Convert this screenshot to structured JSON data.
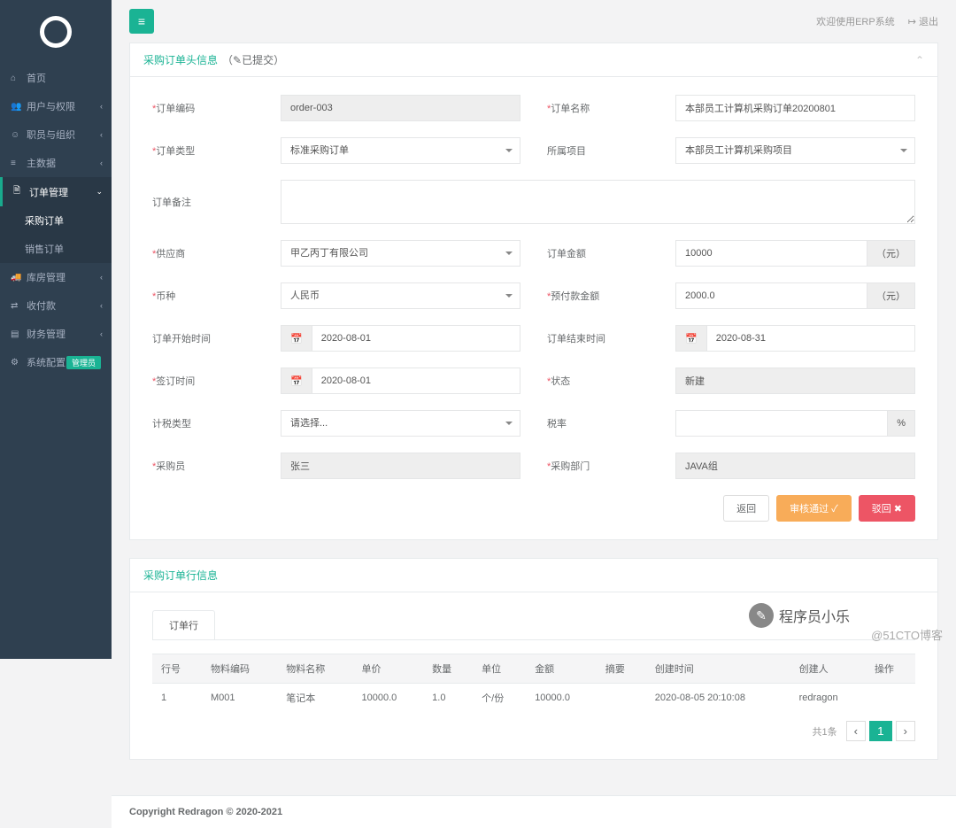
{
  "topbar": {
    "welcome": "欢迎使用ERP系统",
    "logout": "退出"
  },
  "sidebar": {
    "items": [
      {
        "icon": "⌂",
        "label": "首页"
      },
      {
        "icon": "👥",
        "label": "用户与权限",
        "arrow": "‹"
      },
      {
        "icon": "☺",
        "label": "职员与组织",
        "arrow": "‹"
      },
      {
        "icon": "≡",
        "label": "主数据",
        "arrow": "‹"
      },
      {
        "icon": "🗎",
        "label": "订单管理",
        "arrow": "⌄",
        "active": true,
        "sub": [
          {
            "label": "采购订单",
            "sel": true
          },
          {
            "label": "销售订单"
          }
        ]
      },
      {
        "icon": "🚚",
        "label": "库房管理",
        "arrow": "‹"
      },
      {
        "icon": "⇄",
        "label": "收付款",
        "arrow": "‹"
      },
      {
        "icon": "▤",
        "label": "财务管理",
        "arrow": "‹"
      },
      {
        "icon": "⚙",
        "label": "系统配置",
        "badge": "管理员"
      }
    ]
  },
  "panel1": {
    "title": "采购订单头信息",
    "status": "（✎已提交）"
  },
  "form": {
    "order_code": {
      "label": "订单编码",
      "value": "order-003"
    },
    "order_name": {
      "label": "订单名称",
      "value": "本部员工计算机采购订单20200801"
    },
    "order_type": {
      "label": "订单类型",
      "value": "标准采购订单"
    },
    "project": {
      "label": "所属项目",
      "value": "本部员工计算机采购项目"
    },
    "remark": {
      "label": "订单备注",
      "value": ""
    },
    "supplier": {
      "label": "供应商",
      "value": "甲乙丙丁有限公司"
    },
    "amount": {
      "label": "订单金额",
      "value": "10000",
      "unit": "（元）"
    },
    "currency": {
      "label": "币种",
      "value": "人民币"
    },
    "prepay": {
      "label": "预付款金额",
      "value": "2000.0",
      "unit": "（元）"
    },
    "start": {
      "label": "订单开始时间",
      "value": "2020-08-01"
    },
    "end": {
      "label": "订单结束时间",
      "value": "2020-08-31"
    },
    "sign": {
      "label": "签订时间",
      "value": "2020-08-01"
    },
    "state": {
      "label": "状态",
      "value": "新建"
    },
    "tax_type": {
      "label": "计税类型",
      "value": "请选择..."
    },
    "tax_rate": {
      "label": "税率",
      "value": "",
      "unit": "%"
    },
    "buyer": {
      "label": "采购员",
      "value": "张三"
    },
    "dept": {
      "label": "采购部门",
      "value": "JAVA组"
    }
  },
  "buttons": {
    "back": "返回",
    "approve": "审核通过 ✓",
    "reject": "驳回 ✖"
  },
  "panel2": {
    "title": "采购订单行信息",
    "tab": "订单行"
  },
  "table": {
    "headers": [
      "行号",
      "物料编码",
      "物料名称",
      "单价",
      "数量",
      "单位",
      "金额",
      "摘要",
      "创建时间",
      "创建人",
      "操作"
    ],
    "rows": [
      [
        "1",
        "M001",
        "笔记本",
        "10000.0",
        "1.0",
        "个/份",
        "10000.0",
        "",
        "2020-08-05 20:10:08",
        "redragon",
        ""
      ]
    ]
  },
  "pagination": {
    "info": "共1条",
    "page": "1"
  },
  "footer": {
    "text": "Copyright Redragon © 2020-2021"
  },
  "watermark": "@51CTO博客",
  "wechat": "程序员小乐"
}
